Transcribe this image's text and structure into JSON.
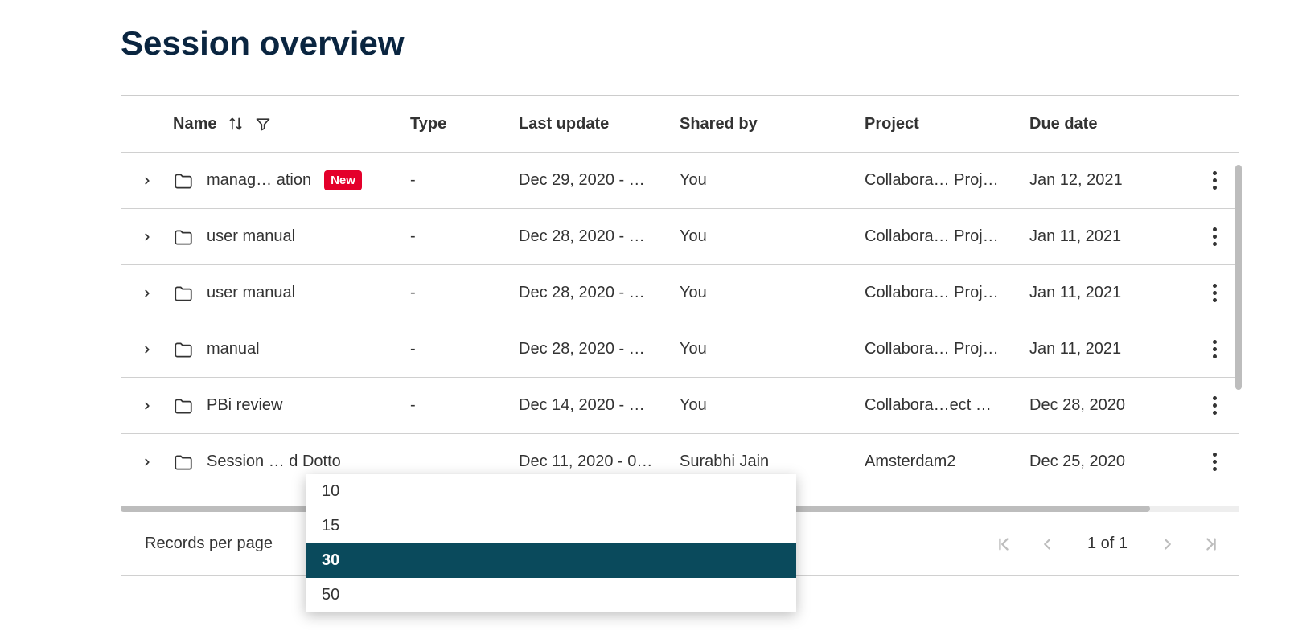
{
  "page": {
    "title": "Session overview"
  },
  "columns": {
    "name": "Name",
    "type": "Type",
    "last_update": "Last update",
    "shared_by": "Shared by",
    "project": "Project",
    "due_date": "Due date"
  },
  "rows": [
    {
      "name": "manag… ation",
      "new": true,
      "type": "-",
      "last_update": "Dec 29, 2020 - …",
      "shared_by": "You",
      "project": "Collabora… Proj…",
      "due_date": "Jan 12, 2021"
    },
    {
      "name": "user manual",
      "new": false,
      "type": "-",
      "last_update": "Dec 28, 2020 - …",
      "shared_by": "You",
      "project": "Collabora… Proj…",
      "due_date": "Jan 11, 2021"
    },
    {
      "name": "user manual",
      "new": false,
      "type": "-",
      "last_update": "Dec 28, 2020 - …",
      "shared_by": "You",
      "project": "Collabora… Proj…",
      "due_date": "Jan 11, 2021"
    },
    {
      "name": "manual",
      "new": false,
      "type": "-",
      "last_update": "Dec 28, 2020 - …",
      "shared_by": "You",
      "project": "Collabora… Proj…",
      "due_date": "Jan 11, 2021"
    },
    {
      "name": "PBi review",
      "new": false,
      "type": "-",
      "last_update": "Dec 14, 2020 - …",
      "shared_by": "You",
      "project": "Collabora…ect …",
      "due_date": "Dec 28, 2020"
    },
    {
      "name": "Session … d Dotto",
      "new": false,
      "type": "",
      "last_update": "Dec 11, 2020 - 0…",
      "shared_by": "Surabhi Jain",
      "project": "Amsterdam2",
      "due_date": "Dec 25, 2020"
    }
  ],
  "new_badge": "New",
  "pager": {
    "label": "Records per page",
    "info": "1 of 1"
  },
  "dropdown": {
    "options": [
      "10",
      "15",
      "30",
      "50"
    ],
    "selected": "30"
  }
}
